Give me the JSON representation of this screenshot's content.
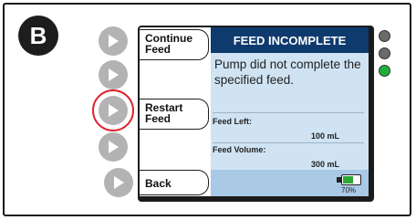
{
  "figure_badge": "B",
  "softkeys": [
    {
      "line1": "Continue",
      "line2": "Feed"
    },
    {
      "line1": "",
      "line2": ""
    },
    {
      "line1": "Restart",
      "line2": "Feed"
    },
    {
      "line1": "",
      "line2": ""
    },
    {
      "line1": "Back",
      "line2": ""
    }
  ],
  "screen": {
    "title": "FEED INCOMPLETE",
    "message": "Pump did not complete the specified feed.",
    "feed_left_label": "Feed Left:",
    "feed_left_value": "100 mL",
    "feed_volume_label": "Feed Volume:",
    "feed_volume_value": "300 mL"
  },
  "battery": {
    "percent_text": "70%",
    "level": 0.7
  },
  "indicator_lights": [
    {
      "name": "top",
      "color": "#6a6a6a"
    },
    {
      "name": "middle",
      "color": "#6a6a6a"
    },
    {
      "name": "bottom",
      "color": "#1fae3c"
    }
  ],
  "colors": {
    "header": "#0f3a6e",
    "panel": "#cfe3f3",
    "highlight_ring": "#e0222e",
    "side_button": "#b3b3b3"
  }
}
